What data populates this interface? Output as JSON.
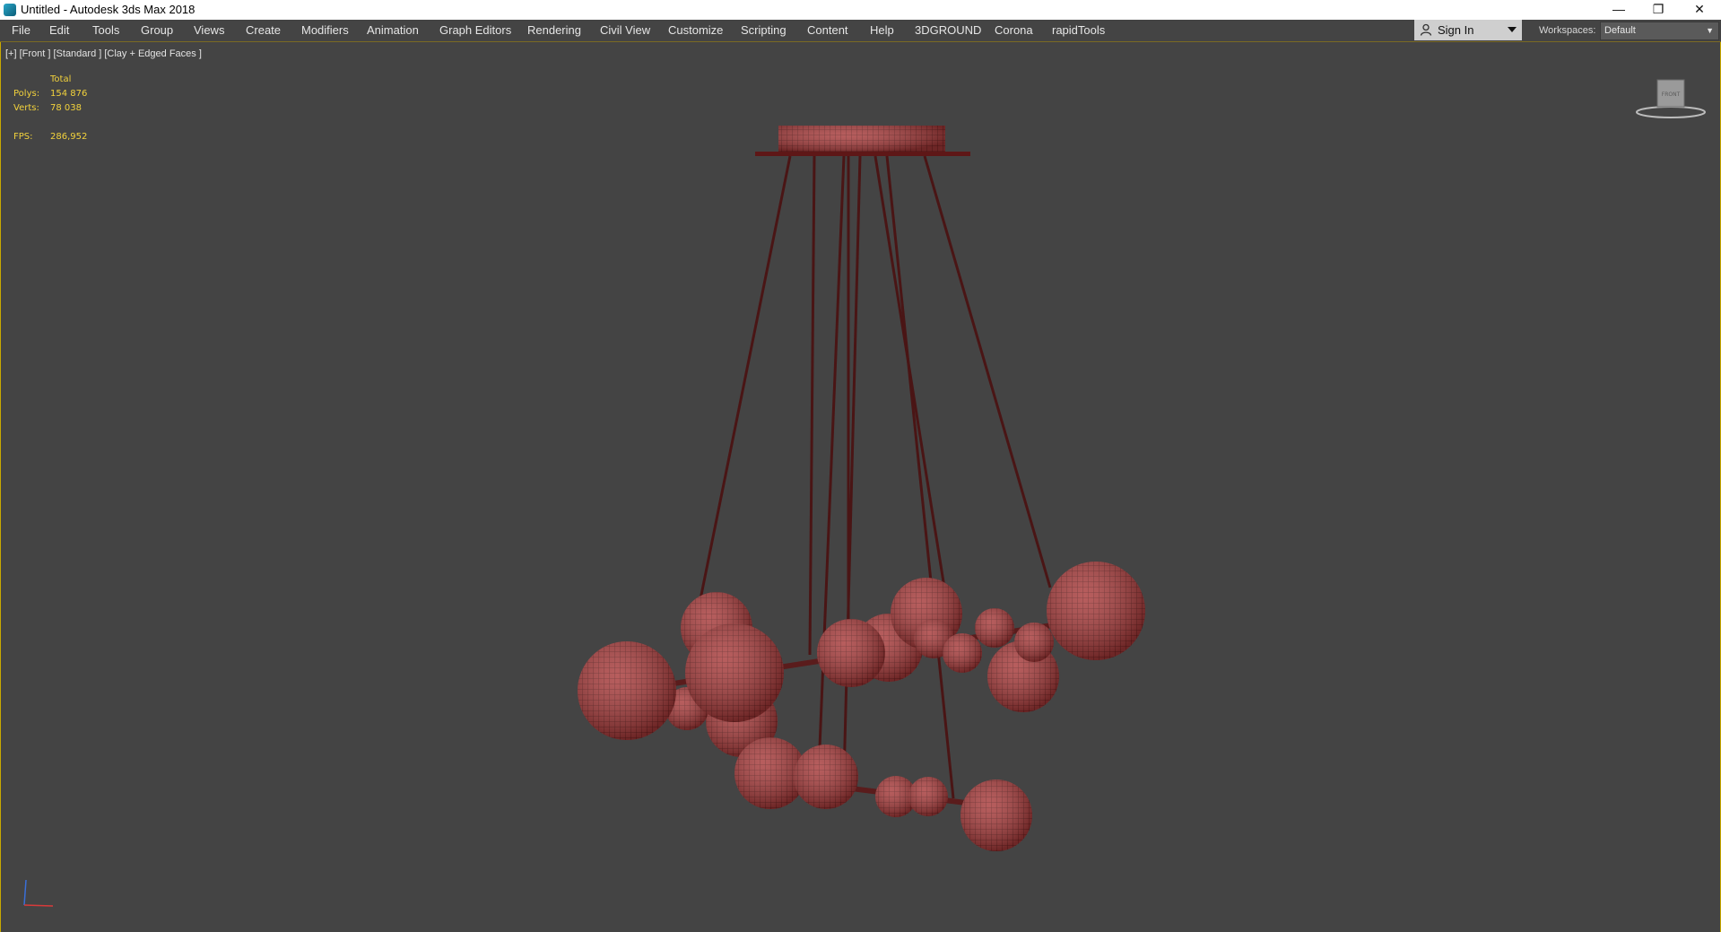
{
  "window": {
    "title": "Untitled - Autodesk 3ds Max 2018",
    "minimize_glyph": "—",
    "restore_glyph": "❐",
    "close_glyph": "✕"
  },
  "menu": {
    "items": [
      {
        "label": "File"
      },
      {
        "label": "Edit"
      },
      {
        "label": "Tools"
      },
      {
        "label": "Group"
      },
      {
        "label": "Views"
      },
      {
        "label": "Create"
      },
      {
        "label": "Modifiers"
      },
      {
        "label": "Animation"
      },
      {
        "label": "Graph Editors"
      },
      {
        "label": "Rendering"
      },
      {
        "label": "Civil View"
      },
      {
        "label": "Customize"
      },
      {
        "label": "Scripting"
      },
      {
        "label": "Content"
      },
      {
        "label": "Help"
      },
      {
        "label": "3DGROUND"
      },
      {
        "label": "Corona"
      },
      {
        "label": "rapidTools"
      }
    ],
    "sign_in": "Sign In",
    "workspaces_label": "Workspaces:",
    "workspace_value": "Default"
  },
  "viewport": {
    "label": "[+] [Front ] [Standard ] [Clay + Edged Faces ]",
    "stats": {
      "total_label": "Total",
      "polys_label": "Polys:",
      "polys_value": "154 876",
      "verts_label": "Verts:",
      "verts_value": "78 038",
      "fps_label": "FPS:",
      "fps_value": "286,952"
    },
    "viewcube_face": "FRONT"
  },
  "colors": {
    "accent": "#c9a900",
    "model": "#a83a3a",
    "model_dark": "#6e1e1e",
    "stats_text": "#f2d23c"
  },
  "icons": {
    "app": "3ds-max-icon",
    "signin": "person-icon",
    "gizmo": "axis-gizmo-icon",
    "viewcube": "viewcube-icon"
  }
}
